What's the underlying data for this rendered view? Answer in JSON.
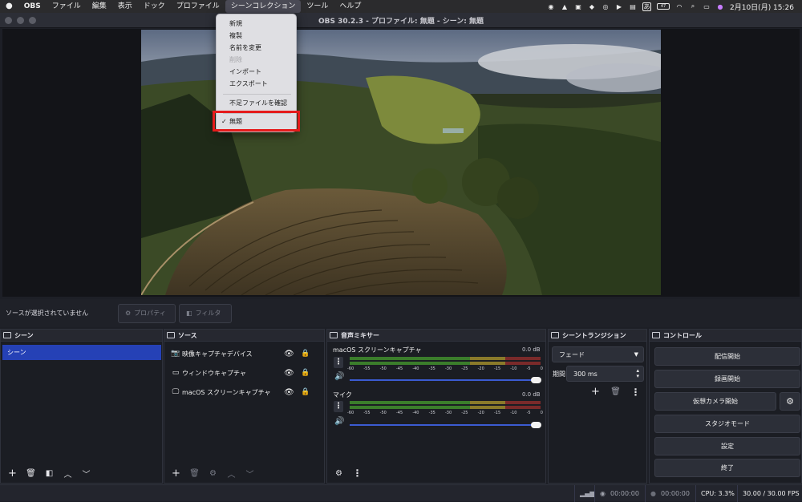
{
  "menubar": {
    "app": "OBS",
    "items": [
      "ファイル",
      "編集",
      "表示",
      "ドック",
      "プロファイル",
      "シーンコレクション",
      "ツール",
      "ヘルプ"
    ],
    "active_index": 5,
    "input_method": "あ",
    "battery": "47",
    "clock": "2月10日(月)  15:26"
  },
  "window": {
    "title": "OBS 30.2.3 - プロファイル: 無題 - シーン: 無題"
  },
  "scene_menu": {
    "items": [
      {
        "label": "新規",
        "disabled": false
      },
      {
        "label": "複製",
        "disabled": false
      },
      {
        "label": "名前を変更",
        "disabled": false
      },
      {
        "label": "削除",
        "disabled": true
      },
      {
        "label": "インポート",
        "disabled": false
      },
      {
        "label": "エクスポート",
        "disabled": false
      },
      {
        "label": "不足ファイルを確認",
        "disabled": false
      }
    ],
    "checked_item": "無題",
    "check_mark": "✓"
  },
  "source_toolbar": {
    "no_selection": "ソースが選択されていません",
    "properties": "プロパティ",
    "filters": "フィルタ"
  },
  "scenes": {
    "title": "シーン",
    "items": [
      "シーン"
    ]
  },
  "sources": {
    "title": "ソース",
    "items": [
      {
        "name": "映像キャプチャデバイス",
        "icon": "camera-icon"
      },
      {
        "name": "ウィンドウキャプチャ",
        "icon": "window-icon"
      },
      {
        "name": "macOS スクリーンキャプチャ",
        "icon": "monitor-icon"
      }
    ]
  },
  "mixer": {
    "title": "音声ミキサー",
    "channels": [
      {
        "name": "macOS スクリーンキャプチャ",
        "db": "0.0 dB",
        "volume": 1.0
      },
      {
        "name": "マイク",
        "db": "0.0 dB",
        "volume": 1.0
      }
    ],
    "ticks": [
      "-60",
      "-55",
      "-50",
      "-45",
      "-40",
      "-35",
      "-30",
      "-25",
      "-20",
      "-15",
      "-10",
      "-5",
      "0"
    ]
  },
  "transitions": {
    "title": "シーントランジション",
    "selected": "フェード",
    "duration_label": "期間",
    "duration_value": "300 ms"
  },
  "controls": {
    "title": "コントロール",
    "start_streaming": "配信開始",
    "start_recording": "録画開始",
    "start_virtual_camera": "仮想カメラ開始",
    "studio_mode": "スタジオモード",
    "settings": "設定",
    "exit": "終了"
  },
  "status": {
    "stream_time": "00:00:00",
    "record_time": "00:00:00",
    "cpu": "CPU: 3.3%",
    "fps": "30.00 / 30.00 FPS"
  },
  "colors": {
    "accent_selection": "#2541b6",
    "highlight_box": "#e51b1b",
    "meter_green": "#3b7d2b",
    "meter_yellow": "#8a7a2a",
    "meter_red": "#7a2a2a",
    "volume_track": "#3b5bd1"
  }
}
